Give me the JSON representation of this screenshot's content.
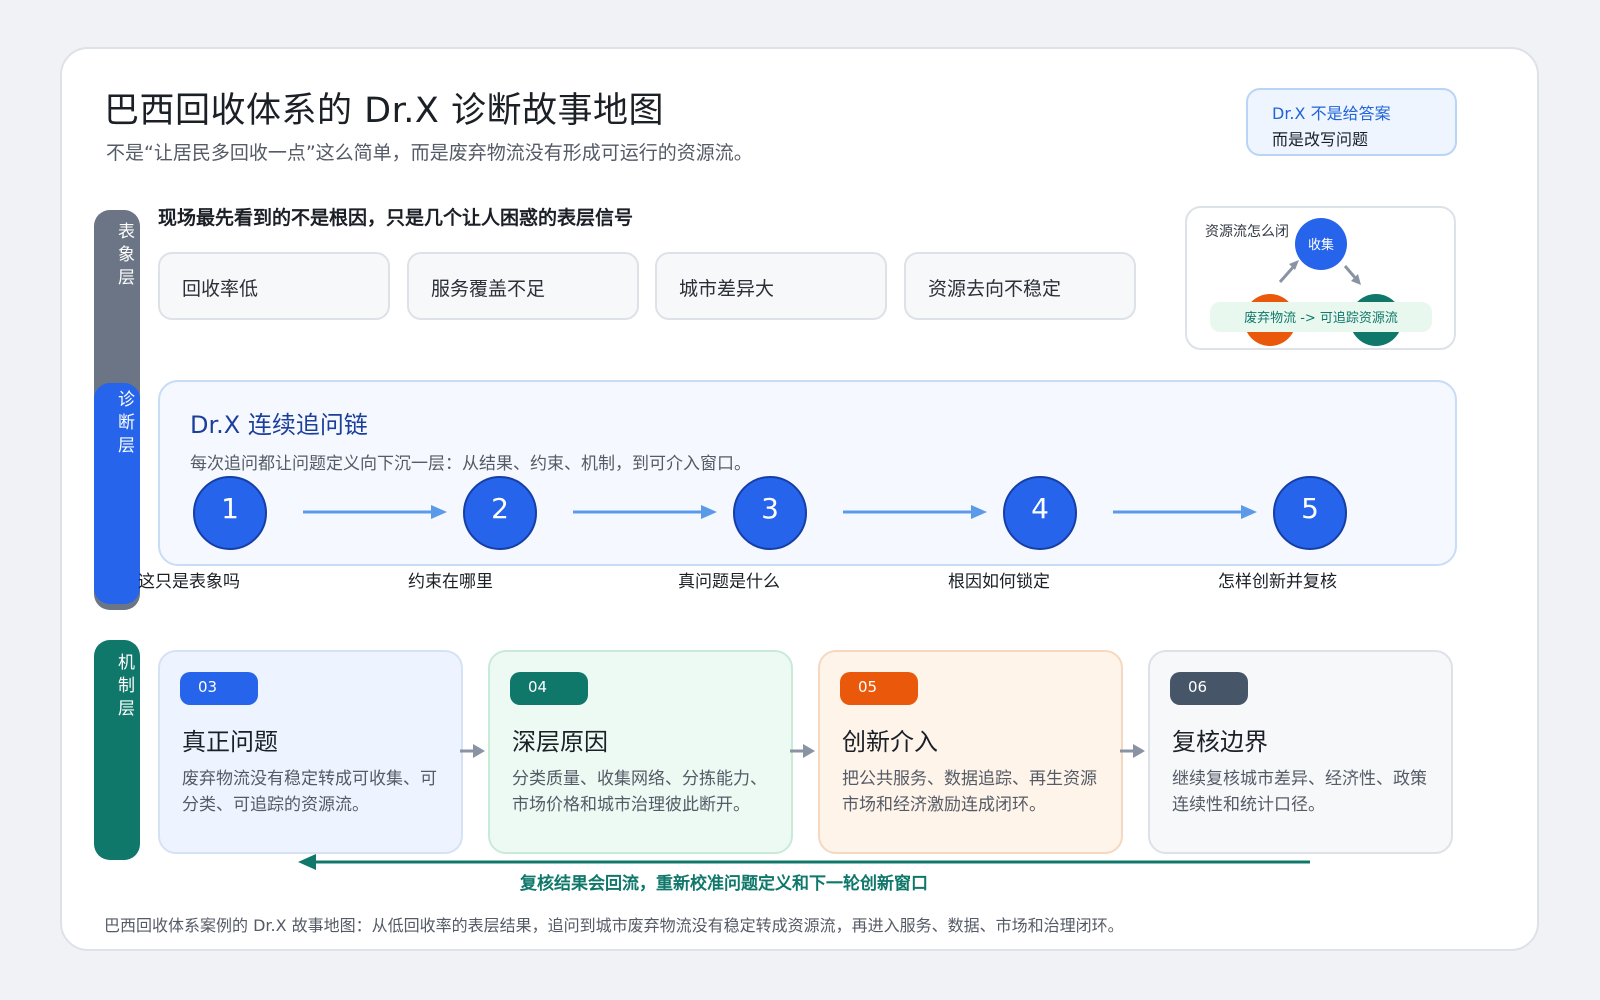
{
  "header": {
    "title": "巴西回收体系的 Dr.X 诊断故事地图",
    "subtitle": "不是“让居民多回收一点”这么简单，而是废弃物流没有形成可运行的资源流。"
  },
  "note": {
    "line1": "Dr.X 不是给答案",
    "line2": "而是改写问题"
  },
  "layers": {
    "surface": "表象层",
    "diagnosis": "诊断层",
    "mechanism": "机制层"
  },
  "colors": {
    "blue": "#2564eb",
    "teal": "#10786b",
    "orange": "#ea580c",
    "slate": "#475569",
    "gray": "#6b7585"
  },
  "surface": {
    "heading": "现场最先看到的不是根因，只是几个让人困惑的表层信号",
    "symptoms": [
      "回收率低",
      "服务覆盖不足",
      "城市差异大",
      "资源去向不稳定"
    ]
  },
  "flow_diagram": {
    "title": "资源流怎么闭",
    "node_top": "收集",
    "caption": "废弃物流 -> 可追踪资源流"
  },
  "diagnosis": {
    "title": "Dr.X 连续追问链",
    "desc": "每次追问都让问题定义向下沉一层：从结果、约束、机制，到可介入窗口。",
    "steps": [
      {
        "num": "1",
        "label": "这只是表象吗"
      },
      {
        "num": "2",
        "label": "约束在哪里"
      },
      {
        "num": "3",
        "label": "真问题是什么"
      },
      {
        "num": "4",
        "label": "根因如何锁定"
      },
      {
        "num": "5",
        "label": "怎样创新并复核"
      }
    ]
  },
  "mechanism": {
    "cards": [
      {
        "badge": "03",
        "title": "真正问题",
        "desc": "废弃物流没有稳定转成可收集、可分类、可追踪的资源流。"
      },
      {
        "badge": "04",
        "title": "深层原因",
        "desc": "分类质量、收集网络、分拣能力、市场价格和城市治理彼此断开。"
      },
      {
        "badge": "05",
        "title": "创新介入",
        "desc": "把公共服务、数据追踪、再生资源市场和经济激励连成闭环。"
      },
      {
        "badge": "06",
        "title": "复核边界",
        "desc": "继续复核城市差异、经济性、政策连续性和统计口径。"
      }
    ],
    "feedback": "复核结果会回流，重新校准问题定义和下一轮创新窗口"
  },
  "footer": "巴西回收体系案例的 Dr.X 故事地图：从低回收率的表层结果，追问到城市废弃物流没有稳定转成资源流，再进入服务、数据、市场和治理闭环。"
}
